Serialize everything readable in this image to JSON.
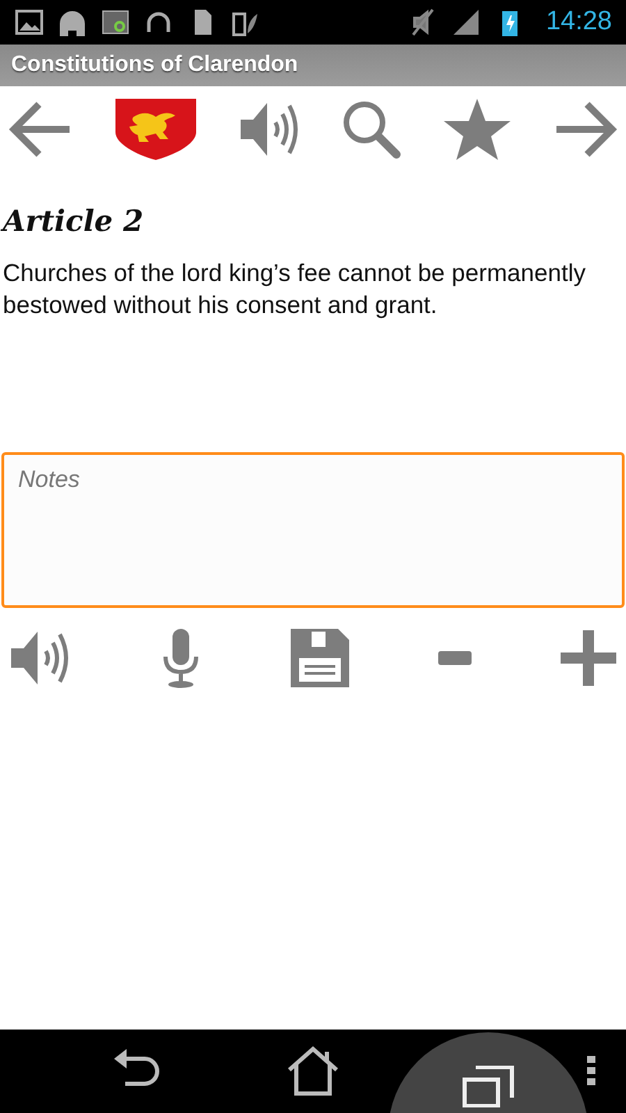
{
  "status_bar": {
    "time": "14:28"
  },
  "title_bar": {
    "title": "Constitutions of Clarendon"
  },
  "article": {
    "heading": "Article 2",
    "text": "Churches of the lord king’s fee cannot be permanently bestowed without his consent and grant."
  },
  "notes": {
    "placeholder": "Notes"
  }
}
